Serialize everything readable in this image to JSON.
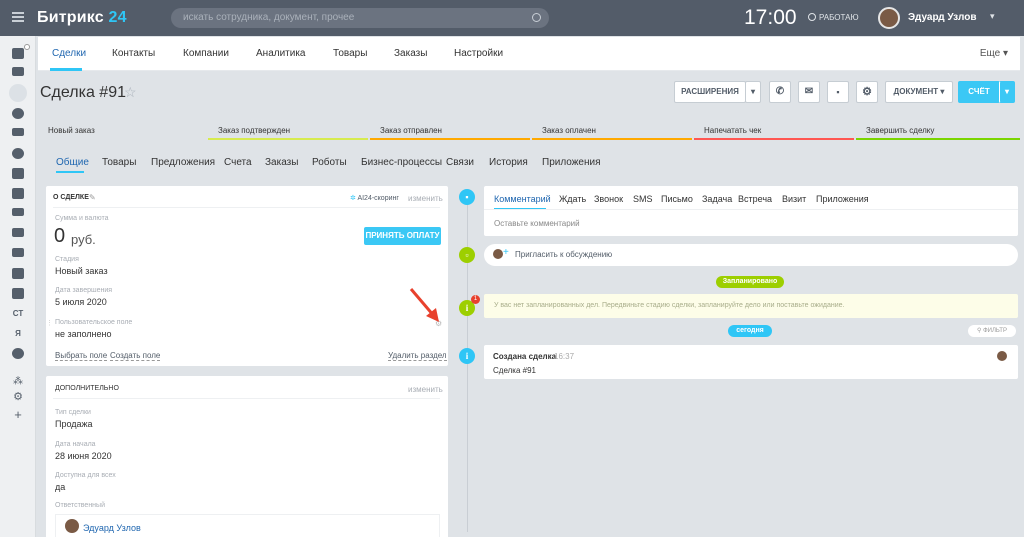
{
  "topbar": {
    "logo_main": "Битрикс",
    "logo_num": "24",
    "search_placeholder": "искать сотрудника, документ, прочее",
    "clock": "17:00",
    "status": "РАБОТАЮ",
    "user_name": "Эдуард Узлов"
  },
  "sidebar": {
    "icons": [
      "robot-icon",
      "calendar-icon",
      "filter-icon",
      "chart-icon",
      "printer-icon",
      "globe-icon",
      "list-icon",
      "check-icon",
      "mail-icon",
      "car-icon",
      "cart-icon",
      "window-icon",
      "apps-icon"
    ],
    "text_items": [
      "СТ",
      "Я"
    ]
  },
  "tabs": {
    "items": [
      "Сделки",
      "Контакты",
      "Компании",
      "Аналитика",
      "Товары",
      "Заказы",
      "Настройки"
    ],
    "more": "Еще"
  },
  "deal": {
    "title": "Сделка #91",
    "buttons": {
      "extensions": "РАСШИРЕНИЯ",
      "document": "ДОКУМЕНТ",
      "invoice": "СЧЁТ"
    }
  },
  "stages": [
    {
      "label": "Новый заказ",
      "color": "#dfe3e7"
    },
    {
      "label": "Заказ подтвержден",
      "color": "#d7eb4f"
    },
    {
      "label": "Заказ отправлен",
      "color": "#ffa900"
    },
    {
      "label": "Заказ оплачен",
      "color": "#ffa900"
    },
    {
      "label": "Напечатать чек",
      "color": "#ff5752"
    },
    {
      "label": "Завершить сделку",
      "color": "#7bd500"
    }
  ],
  "subtabs": [
    "Общие",
    "Товары",
    "Предложения",
    "Счета",
    "Заказы",
    "Роботы",
    "Бизнес-процессы",
    "Связи",
    "История",
    "Приложения"
  ],
  "about": {
    "header": "О СДЕЛКЕ",
    "scoring": "AI24-скоринг",
    "edit": "изменить",
    "sum_label": "Сумма и валюта",
    "sum_value": "0",
    "currency": "руб.",
    "accept_btn": "ПРИНЯТЬ ОПЛАТУ",
    "stage_label": "Стадия",
    "stage_value": "Новый заказ",
    "close_label": "Дата завершения",
    "close_value": "5 июля 2020",
    "custom_label": "Пользовательское поле",
    "custom_value": "не заполнено",
    "choose_field": "Выбрать поле",
    "create_field": "Создать поле",
    "delete_section": "Удалить раздел"
  },
  "additional": {
    "header": "ДОПОЛНИТЕЛЬНО",
    "edit": "изменить",
    "type_label": "Тип сделки",
    "type_value": "Продажа",
    "start_label": "Дата начала",
    "start_value": "28 июня 2020",
    "avail_label": "Доступна для всех",
    "avail_value": "да",
    "resp_label": "Ответственный",
    "resp_value": "Эдуард Узлов"
  },
  "timeline": {
    "tabs": [
      "Комментарий",
      "Ждать",
      "Звонок",
      "SMS",
      "Письмо",
      "Задача",
      "Встреча",
      "Визит",
      "Приложения"
    ],
    "comment_placeholder": "Оставьте комментарий",
    "invite": "Пригласить к обсуждению",
    "planned": "Запланировано",
    "planned_text": "У вас нет запланированных дел. Передвиньте стадию сделки, запланируйте дело или поставьте ожидание.",
    "today": "сегодня",
    "filter": "ФИЛЬТР",
    "created_title": "Создана сделка",
    "created_time": "16:37",
    "created_body": "Сделка #91",
    "warn_badge": "1"
  },
  "colors": {
    "accent": "#2fc6f6",
    "topbar": "#535c69",
    "green": "#9dcf00",
    "link": "#2067b0"
  }
}
